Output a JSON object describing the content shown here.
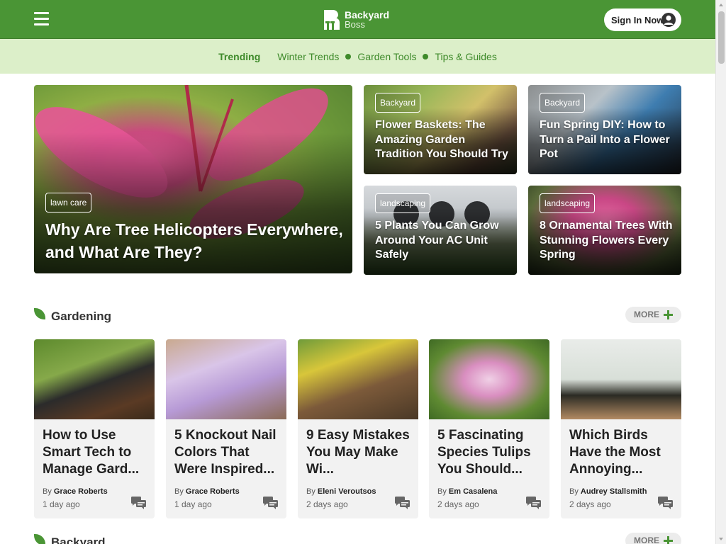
{
  "brand": {
    "name_line1": "Backyard",
    "name_line2": "Boss",
    "color": "#4a9535"
  },
  "header": {
    "signin_label": "Sign In Now",
    "menu_icon": "hamburger-menu-icon",
    "user_icon": "user-avatar-icon"
  },
  "trending": {
    "label": "Trending",
    "links": [
      "Winter Trends",
      "Garden Tools",
      "Tips & Guides"
    ]
  },
  "hero": {
    "main": {
      "tag": "lawn care",
      "title": "Why Are Tree Helicopters Everywhere, and What Are They?"
    },
    "side": [
      {
        "tag": "Backyard",
        "title": "Flower Baskets: The Amazing Garden Tradition You Should Try"
      },
      {
        "tag": "Backyard",
        "title": "Fun Spring DIY: How to Turn a Pail Into a Flower Pot"
      },
      {
        "tag": "landscaping",
        "title": "5 Plants You Can Grow Around Your AC Unit Safely"
      },
      {
        "tag": "landscaping",
        "title": "8 Ornamental Trees With Stunning Flowers Every Spring"
      }
    ]
  },
  "sections": [
    {
      "title": "Gardening",
      "more_label": "MORE",
      "articles": [
        {
          "title": "How to Use Smart Tech to Manage Gard...",
          "by": "By",
          "author": "Grace Roberts",
          "time": "1 day ago"
        },
        {
          "title": "5 Knockout Nail Colors That Were Inspired...",
          "by": "By",
          "author": "Grace Roberts",
          "time": "1 day ago"
        },
        {
          "title": "9 Easy Mistakes You May Make Wi...",
          "by": "By",
          "author": "Eleni Veroutsos",
          "time": "2 days ago"
        },
        {
          "title": "5 Fascinating Species Tulips You Should...",
          "by": "By",
          "author": "Em Casalena",
          "time": "2 days ago"
        },
        {
          "title": "Which Birds Have the Most Annoying...",
          "by": "By",
          "author": "Audrey Stallsmith",
          "time": "2 days ago"
        }
      ]
    },
    {
      "title": "Backyard",
      "more_label": "MORE"
    }
  ]
}
